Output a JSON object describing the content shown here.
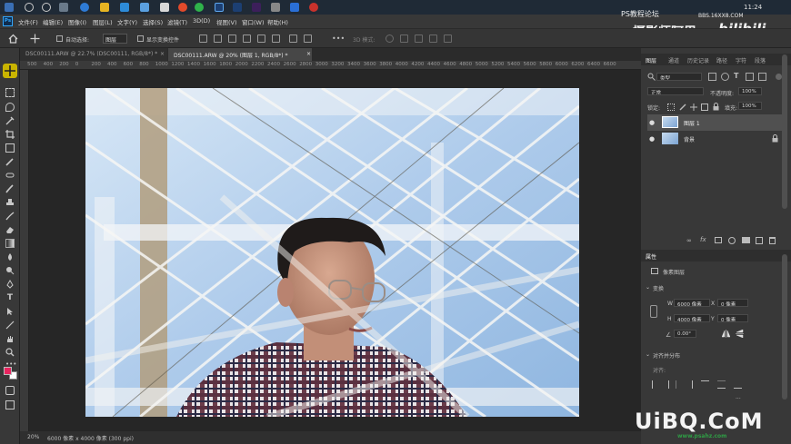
{
  "taskbar": {
    "clock": "11:24",
    "brand_color": "#1f2a36"
  },
  "menubar": {
    "ps_logo": "Ps",
    "items": [
      "文件(F)",
      "编辑(E)",
      "图像(I)",
      "图层(L)",
      "文字(Y)",
      "选择(S)",
      "滤镜(T)",
      "3D(D)",
      "视图(V)",
      "窗口(W)",
      "帮助(H)"
    ]
  },
  "options_bar": {
    "auto_select_label": "自动选择:",
    "auto_select_value": "图层",
    "show_transform_label": "显示变换控件",
    "mode_3d": "3D 模式:"
  },
  "document_tabs": [
    {
      "label": "DSC00111.ARW @ 22.7% (DSC00111, RGB/8*) *",
      "active": false
    },
    {
      "label": "DSC00111.ARW @ 20% (图层 1, RGB/8*) *",
      "active": true
    }
  ],
  "ruler_labels": [
    "500",
    "400",
    "200",
    "0",
    "200",
    "400",
    "600",
    "800",
    "1000",
    "1200",
    "1400",
    "1600",
    "1800",
    "2000",
    "2200",
    "2400",
    "2600",
    "2800",
    "3000",
    "3200",
    "3400",
    "3600",
    "3800",
    "4000",
    "4200",
    "4400",
    "4600",
    "4800",
    "5000",
    "5200",
    "5400",
    "5600",
    "5800",
    "6000",
    "6200",
    "6400",
    "6600"
  ],
  "status_bar": {
    "zoom": "20%",
    "doc_size": "6000 像素 x 4000 像素 (300 ppi)"
  },
  "layers_panel": {
    "tabs": [
      "图层",
      "通道",
      "历史记录",
      "路径",
      "字符",
      "段落"
    ],
    "filter_label": "类型",
    "blend_mode": "正常",
    "opacity_label": "不透明度:",
    "opacity_value": "100%",
    "lock_label": "锁定:",
    "fill_label": "填充:",
    "fill_value": "100%",
    "layers": [
      {
        "name": "图层 1",
        "selected": true
      },
      {
        "name": "背景",
        "selected": false,
        "locked": true
      }
    ]
  },
  "properties_panel": {
    "title": "属性",
    "subtitle": "像素图层",
    "transform_label": "变换",
    "w_label": "W",
    "w_value": "6000 像素",
    "x_label": "X",
    "x_value": "0 像素",
    "h_label": "H",
    "h_value": "4000 像素",
    "y_label": "Y",
    "y_value": "0 像素",
    "angle_value": "0.00°",
    "align_label": "对齐并分布",
    "align_sub": "对齐:",
    "more": "..."
  },
  "watermarks": {
    "top_right_small": "PS教程论坛",
    "top_right_url": "BBS.16XX8.COM",
    "channel_name": "摄影师阿里",
    "bili": "bilibili",
    "bottom_brand": "UiBQ.CoM",
    "bottom_url": "www.psahz.com"
  },
  "colors": {
    "foreground": "#e8245f",
    "background": "#ffffff",
    "active_tool_highlight": "#c9b400"
  }
}
